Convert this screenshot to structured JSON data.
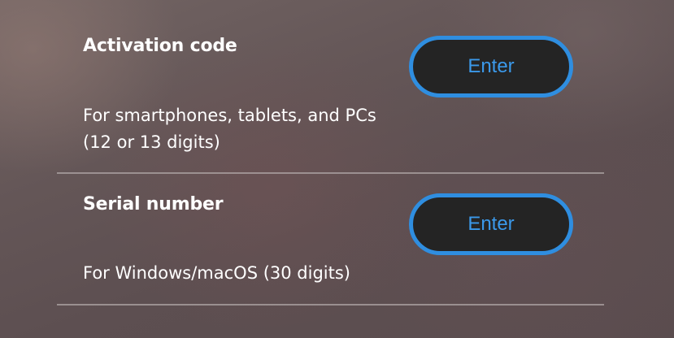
{
  "activation": {
    "title": "Activation code",
    "description_line1": "For smartphones, tablets, and PCs",
    "description_line2": "(12 or 13 digits)",
    "button_label": "Enter"
  },
  "serial": {
    "title": "Serial number",
    "description_line1": "For Windows/macOS (30 digits)",
    "button_label": "Enter"
  },
  "colors": {
    "button_border": "#2f8ee0",
    "button_text": "#3b99ea",
    "button_background": "#242424"
  }
}
